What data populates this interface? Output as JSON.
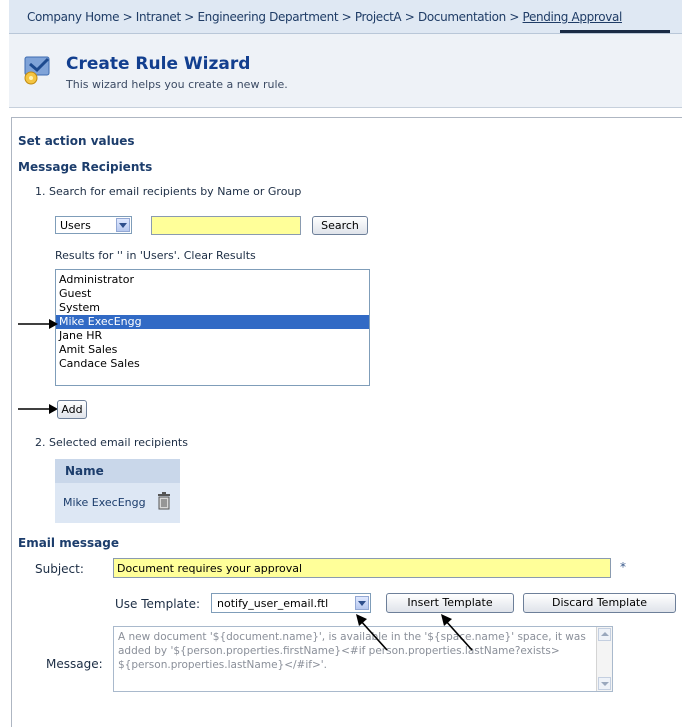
{
  "breadcrumb": {
    "items": [
      "Company Home",
      "Intranet",
      "Engineering Department",
      "ProjectA",
      "Documentation",
      "Pending Approval"
    ],
    "separator": " > "
  },
  "wizard": {
    "title": "Create Rule Wizard",
    "description": "This wizard helps you create a new rule."
  },
  "section": {
    "heading": "Set action values",
    "recipients_heading": "Message Recipients",
    "step1": "1. Search for email recipients by Name or Group",
    "filter_value": "Users",
    "search_value": "",
    "search_button": "Search",
    "results_label": "Results for '' in 'Users'. Clear Results",
    "results": [
      "Administrator",
      "Guest",
      "System",
      "Mike ExecEngg",
      "Jane HR",
      "Amit Sales",
      "Candace Sales"
    ],
    "selected_index": 3,
    "add_button": "Add",
    "step2": "2. Selected email recipients",
    "table_header": "Name",
    "selected_recipients": [
      "Mike ExecEngg"
    ]
  },
  "email": {
    "heading": "Email message",
    "subject_label": "Subject:",
    "subject_value": "Document requires your approval",
    "required_mark": "*",
    "template_label": "Use Template:",
    "template_value": "notify_user_email.ftl",
    "insert_button": "Insert Template",
    "discard_button": "Discard Template",
    "message_label": "Message:",
    "message_value": "A new document '${document.name}', is available in the '${space.name}' space, it was added by '${person.properties.firstName}<#if person.properties.lastName?exists> ${person.properties.lastName}</#if>'."
  },
  "colors": {
    "accent": "#123f8f",
    "selection": "#316ac5",
    "field_highlight": "#ffff99"
  }
}
